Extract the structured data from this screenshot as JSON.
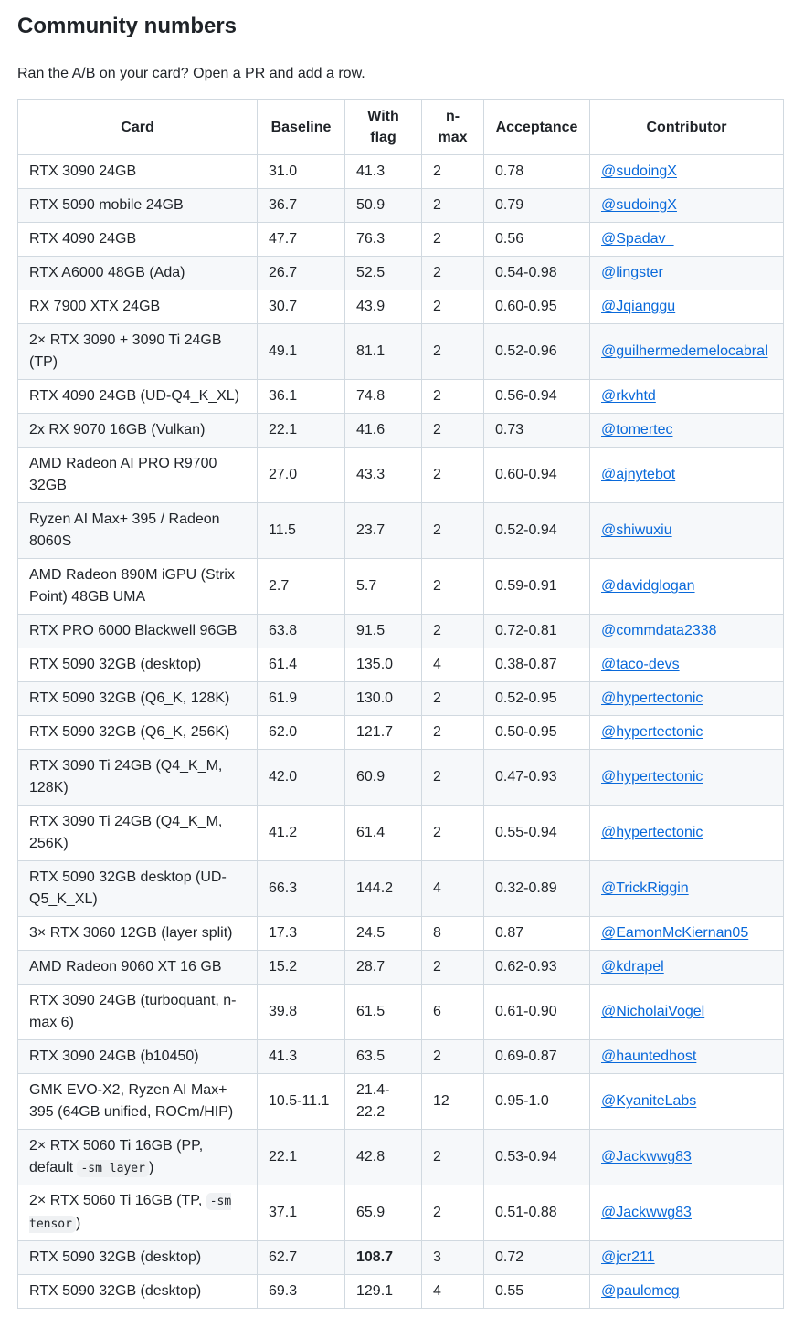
{
  "section": {
    "title": "Community numbers",
    "intro": "Ran the A/B on your card? Open a PR and add a row."
  },
  "table": {
    "headers": {
      "card": "Card",
      "baseline": "Baseline",
      "with_flag": "With flag",
      "n_max": "n-max",
      "acceptance": "Acceptance",
      "contributor": "Contributor"
    },
    "rows": [
      {
        "card": "RTX 3090 24GB",
        "baseline": "31.0",
        "with_flag": "41.3",
        "n_max": "2",
        "acceptance": "0.78",
        "contributor": "@sudoingX"
      },
      {
        "card": "RTX 5090 mobile 24GB",
        "baseline": "36.7",
        "with_flag": "50.9",
        "n_max": "2",
        "acceptance": "0.79",
        "contributor": "@sudoingX"
      },
      {
        "card": "RTX 4090 24GB",
        "baseline": "47.7",
        "with_flag": "76.3",
        "n_max": "2",
        "acceptance": "0.56",
        "contributor": "@Spadav_"
      },
      {
        "card": "RTX A6000 48GB (Ada)",
        "baseline": "26.7",
        "with_flag": "52.5",
        "n_max": "2",
        "acceptance": "0.54-0.98",
        "contributor": "@lingster"
      },
      {
        "card": "RX 7900 XTX 24GB",
        "baseline": "30.7",
        "with_flag": "43.9",
        "n_max": "2",
        "acceptance": "0.60-0.95",
        "contributor": "@Jqianggu"
      },
      {
        "card": "2× RTX 3090 + 3090 Ti 24GB (TP)",
        "baseline": "49.1",
        "with_flag": "81.1",
        "n_max": "2",
        "acceptance": "0.52-0.96",
        "contributor": "@guilhermedemelocabral"
      },
      {
        "card": "RTX 4090 24GB (UD-Q4_K_XL)",
        "baseline": "36.1",
        "with_flag": "74.8",
        "n_max": "2",
        "acceptance": "0.56-0.94",
        "contributor": "@rkvhtd"
      },
      {
        "card": "2x RX 9070 16GB (Vulkan)",
        "baseline": "22.1",
        "with_flag": "41.6",
        "n_max": "2",
        "acceptance": "0.73",
        "contributor": "@tomertec"
      },
      {
        "card": "AMD Radeon AI PRO R9700 32GB",
        "baseline": "27.0",
        "with_flag": "43.3",
        "n_max": "2",
        "acceptance": "0.60-0.94",
        "contributor": "@ajnytebot"
      },
      {
        "card": "Ryzen AI Max+ 395 / Radeon 8060S",
        "baseline": "11.5",
        "with_flag": "23.7",
        "n_max": "2",
        "acceptance": "0.52-0.94",
        "contributor": "@shiwuxiu"
      },
      {
        "card": "AMD Radeon 890M iGPU (Strix Point) 48GB UMA",
        "baseline": "2.7",
        "with_flag": "5.7",
        "n_max": "2",
        "acceptance": "0.59-0.91",
        "contributor": "@davidglogan"
      },
      {
        "card": "RTX PRO 6000 Blackwell 96GB",
        "baseline": "63.8",
        "with_flag": "91.5",
        "n_max": "2",
        "acceptance": "0.72-0.81",
        "contributor": "@commdata2338"
      },
      {
        "card": "RTX 5090 32GB (desktop)",
        "baseline": "61.4",
        "with_flag": "135.0",
        "n_max": "4",
        "acceptance": "0.38-0.87",
        "contributor": "@taco-devs"
      },
      {
        "card": "RTX 5090 32GB (Q6_K, 128K)",
        "baseline": "61.9",
        "with_flag": "130.0",
        "n_max": "2",
        "acceptance": "0.52-0.95",
        "contributor": "@hypertectonic"
      },
      {
        "card": "RTX 5090 32GB (Q6_K, 256K)",
        "baseline": "62.0",
        "with_flag": "121.7",
        "n_max": "2",
        "acceptance": "0.50-0.95",
        "contributor": "@hypertectonic"
      },
      {
        "card": "RTX 3090 Ti 24GB (Q4_K_M, 128K)",
        "baseline": "42.0",
        "with_flag": "60.9",
        "n_max": "2",
        "acceptance": "0.47-0.93",
        "contributor": "@hypertectonic"
      },
      {
        "card": "RTX 3090 Ti 24GB (Q4_K_M, 256K)",
        "baseline": "41.2",
        "with_flag": "61.4",
        "n_max": "2",
        "acceptance": "0.55-0.94",
        "contributor": "@hypertectonic"
      },
      {
        "card": "RTX 5090 32GB desktop (UD-Q5_K_XL)",
        "baseline": "66.3",
        "with_flag": "144.2",
        "n_max": "4",
        "acceptance": "0.32-0.89",
        "contributor": "@TrickRiggin"
      },
      {
        "card": "3× RTX 3060 12GB (layer split)",
        "baseline": "17.3",
        "with_flag": "24.5",
        "n_max": "8",
        "acceptance": "0.87",
        "contributor": "@EamonMcKiernan05"
      },
      {
        "card": "AMD Radeon 9060 XT 16 GB",
        "baseline": "15.2",
        "with_flag": "28.7",
        "n_max": "2",
        "acceptance": "0.62-0.93",
        "contributor": "@kdrapel"
      },
      {
        "card": "RTX 3090 24GB (turboquant, n-max 6)",
        "baseline": "39.8",
        "with_flag": "61.5",
        "n_max": "6",
        "acceptance": "0.61-0.90",
        "contributor": "@NicholaiVogel"
      },
      {
        "card": "RTX 3090 24GB (b10450)",
        "baseline": "41.3",
        "with_flag": "63.5",
        "n_max": "2",
        "acceptance": "0.69-0.87",
        "contributor": "@hauntedhost"
      },
      {
        "card": "GMK EVO-X2, Ryzen AI Max+ 395 (64GB unified, ROCm/HIP)",
        "baseline": "10.5-11.1",
        "with_flag": "21.4-22.2",
        "n_max": "12",
        "acceptance": "0.95-1.0",
        "contributor": "@KyaniteLabs"
      },
      {
        "card_prefix": "2× RTX 5060 Ti 16GB (PP, default ",
        "card_code": "-sm layer",
        "card_suffix": ")",
        "baseline": "22.1",
        "with_flag": "42.8",
        "n_max": "2",
        "acceptance": "0.53-0.94",
        "contributor": "@Jackwwg83"
      },
      {
        "card_prefix": "2× RTX 5060 Ti 16GB (TP, ",
        "card_code": "-sm tensor",
        "card_suffix": ")",
        "baseline": "37.1",
        "with_flag": "65.9",
        "n_max": "2",
        "acceptance": "0.51-0.88",
        "contributor": "@Jackwwg83"
      },
      {
        "card": "RTX 5090 32GB (desktop)",
        "baseline": "62.7",
        "with_flag": "108.7",
        "n_max": "3",
        "acceptance": "0.72",
        "contributor": "@jcr211"
      },
      {
        "card": "RTX 5090 32GB (desktop)",
        "baseline": "69.3",
        "with_flag": "129.1",
        "n_max": "4",
        "acceptance": "0.55",
        "contributor": "@paulomcg"
      }
    ]
  }
}
